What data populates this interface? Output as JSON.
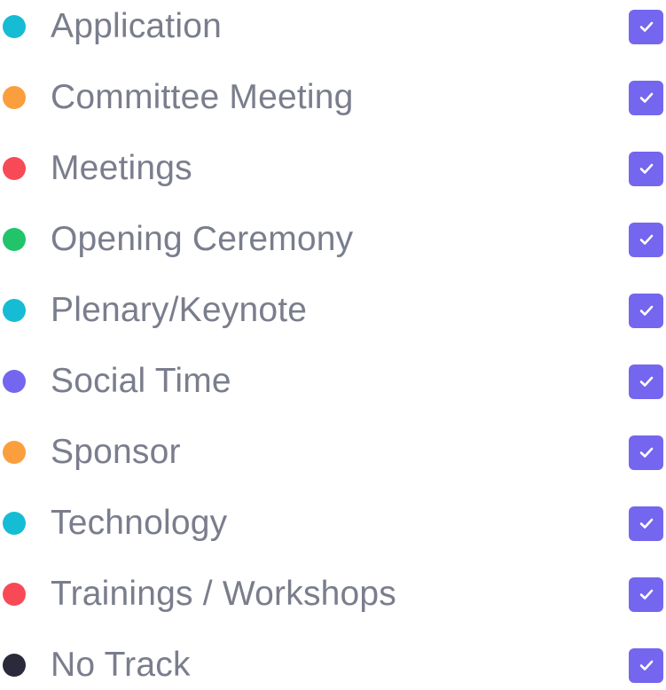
{
  "tracks": [
    {
      "label": "Application",
      "color": "#15bcd4",
      "checked": true
    },
    {
      "label": "Committee Meeting",
      "color": "#fb9e3e",
      "checked": true
    },
    {
      "label": "Meetings",
      "color": "#f84a56",
      "checked": true
    },
    {
      "label": "Opening Ceremony",
      "color": "#22c46b",
      "checked": true
    },
    {
      "label": "Plenary/Keynote",
      "color": "#15bcd4",
      "checked": true
    },
    {
      "label": "Social Time",
      "color": "#7466ee",
      "checked": true
    },
    {
      "label": "Sponsor",
      "color": "#fb9e3e",
      "checked": true
    },
    {
      "label": "Technology",
      "color": "#15bcd4",
      "checked": true
    },
    {
      "label": "Trainings / Workshops",
      "color": "#f84a56",
      "checked": true
    },
    {
      "label": "No Track",
      "color": "#2b2a3d",
      "checked": true
    }
  ],
  "checkbox_color": "#7466ee"
}
